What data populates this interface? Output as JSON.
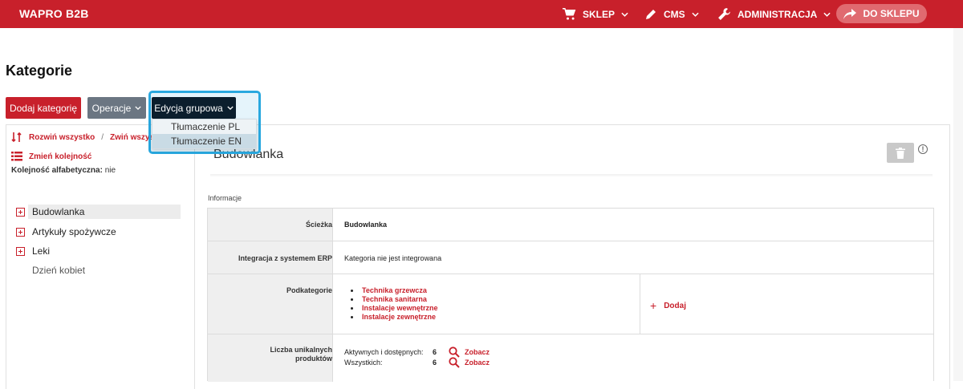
{
  "topbar": {
    "brand": "WAPRO B2B",
    "nav": [
      {
        "label": "SKLEP",
        "icon": "cart-icon"
      },
      {
        "label": "CMS",
        "icon": "pencil-icon"
      },
      {
        "label": "ADMINISTRACJA",
        "icon": "wrench-icon"
      }
    ],
    "shop_button": "DO SKLEPU"
  },
  "page": {
    "title": "Kategorie"
  },
  "toolbar": {
    "add_label": "Dodaj kategorię",
    "operations_label": "Operacje",
    "bulk_edit_label": "Edycja grupowa",
    "bulk_menu": [
      "Tłumaczenie PL",
      "Tłumaczenie EN"
    ]
  },
  "tree": {
    "expand_all": "Rozwiń wszystko",
    "separator": "/",
    "collapse_all": "Zwiń wszystko",
    "change_order": "Zmień kolejność",
    "alpha_label": "Kolejność alfabetyczna:",
    "alpha_value": "nie",
    "items": [
      {
        "label": "Budowlanka",
        "expandable": true
      },
      {
        "label": "Artykuły spożywcze",
        "expandable": true
      },
      {
        "label": "Leki",
        "expandable": true
      },
      {
        "label": "Dzień kobiet",
        "expandable": false
      }
    ]
  },
  "detail": {
    "category_name": "Budowlanka",
    "section_label": "Informacje",
    "rows": {
      "path_label": "Ścieżka",
      "path_value": "Budowlanka",
      "erp_label": "Integracja z systemem ERP",
      "erp_value": "Kategoria nie jest integrowana",
      "sub_label": "Podkategorie",
      "subcategories": [
        "Technika grzewcza",
        "Technika sanitarna",
        "Instalacje wewnętrzne",
        "Instalacje zewnętrzne"
      ],
      "add_sub": "Dodaj",
      "unique_label_1": "Liczba unikalnych",
      "unique_label_2": "produktów",
      "active_label": "Aktywnych i dostępnych:",
      "active_value": "6",
      "all_label": "Wszystkich:",
      "all_value": "6",
      "see_label": "Zobacz"
    }
  },
  "colors": {
    "brand": "#c8202b",
    "dark": "#0b1e2d",
    "grey_button": "#6b7682",
    "highlight": "#29a8df"
  }
}
